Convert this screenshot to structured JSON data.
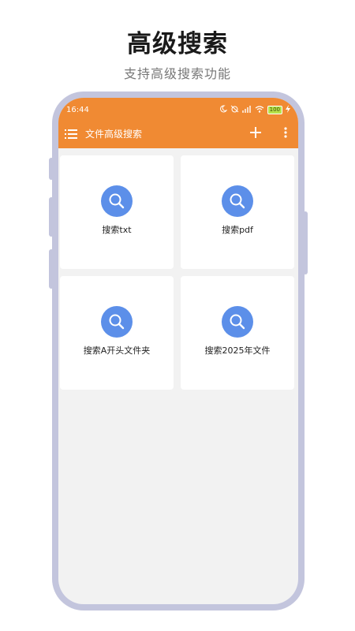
{
  "promo": {
    "title": "高级搜索",
    "subtitle": "支持高级搜索功能"
  },
  "status_bar": {
    "time": "16:44",
    "battery": "100"
  },
  "app_bar": {
    "title": "文件高级搜索",
    "menu_icon": "list-menu-icon",
    "add_icon": "plus-icon",
    "more_icon": "vertical-dots-icon"
  },
  "cards": [
    {
      "label": "搜索txt",
      "icon": "search-icon"
    },
    {
      "label": "搜索pdf",
      "icon": "search-icon"
    },
    {
      "label": "搜索A开头文件夹",
      "icon": "search-icon"
    },
    {
      "label": "搜索2025年文件",
      "icon": "search-icon"
    }
  ],
  "colors": {
    "app_bar": "#f08a33",
    "icon_circle": "#5c8fe9",
    "background": "#f2f2f2",
    "phone_frame": "#c3c5dd"
  }
}
